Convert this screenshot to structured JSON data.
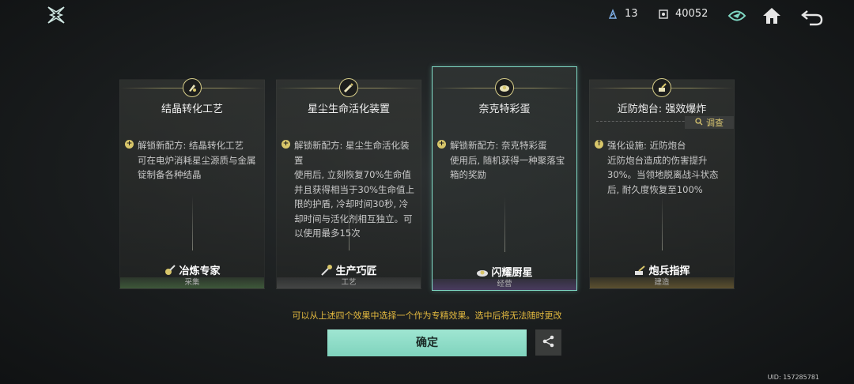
{
  "header": {
    "resource1": {
      "icon": "crystal-icon",
      "value": "13"
    },
    "resource2": {
      "icon": "gear-icon",
      "value": "40052"
    }
  },
  "cards": [
    {
      "title": "结晶转化工艺",
      "icon": "crystal-tools-icon",
      "description": "解锁新配方: 结晶转化工艺\n可在电炉消耗星尘源质与金属锭制备各种结晶",
      "role": "冶炼专家",
      "category": "采集",
      "selected": false
    },
    {
      "title": "星尘生命活化装置",
      "icon": "injector-icon",
      "description": "解锁新配方: 星尘生命活化装置\n使用后, 立刻恢复70%生命值并且获得相当于30%生命值上限的护盾, 冷却时间30秒, 冷却时间与活化剂相互独立。可以使用最多15次",
      "role": "生产巧匠",
      "category": "工艺",
      "selected": false
    },
    {
      "title": "奈克特彩蛋",
      "icon": "egg-plate-icon",
      "description": "解锁新配方: 奈克特彩蛋\n使用后, 随机获得一种聚落宝箱的奖励",
      "role": "闪耀厨星",
      "category": "经营",
      "selected": true
    },
    {
      "title": "近防炮台: 强效爆炸",
      "icon": "turret-icon",
      "description": "强化设施: 近防炮台\n近防炮台造成的伤害提升30%。当领地脱离战斗状态后, 耐久度恢复至100%",
      "role": "炮兵指挥",
      "category": "建造",
      "selected": false,
      "investigate_label": "调查"
    }
  ],
  "hint_text": "可以从上述四个效果中选择一个作为专精效果。选中后将无法随时更改",
  "confirm_label": "确定",
  "uid_text": "UID: 157285781",
  "colors": {
    "accent": "#7fd8c4",
    "hint": "#e3b93f",
    "gold": "#d8c66a"
  }
}
